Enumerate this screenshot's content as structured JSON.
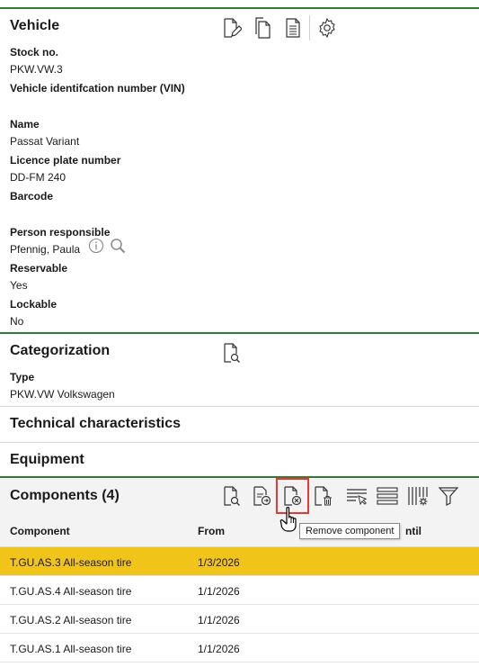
{
  "vehicle": {
    "title": "Vehicle",
    "fields": [
      {
        "label": "Stock no.",
        "value": "PKW.VW.3"
      },
      {
        "label": "Vehicle identifcation number (VIN)",
        "value": ""
      },
      {
        "label": "Name",
        "value": "Passat Variant"
      },
      {
        "label": "Licence plate number",
        "value": "DD-FM 240"
      },
      {
        "label": "Barcode",
        "value": ""
      },
      {
        "label": "Person responsible",
        "value": "Pfennig, Paula"
      },
      {
        "label": "Reservable",
        "value": "Yes"
      },
      {
        "label": "Lockable",
        "value": "No"
      }
    ],
    "toolbar_icons": [
      "edit-document-icon",
      "copy-document-icon",
      "document-icon",
      "settings-gear-icon"
    ]
  },
  "categorization": {
    "title": "Categorization",
    "type_label": "Type",
    "type_value": "PKW.VW Volkswagen"
  },
  "technical": {
    "title": "Technical characteristics"
  },
  "equipment": {
    "title": "Equipment"
  },
  "components": {
    "title": "Components (4)",
    "columns": [
      "Component",
      "From",
      "Until"
    ],
    "column_until_visible": "ntil",
    "rows": [
      {
        "component": "T.GU.AS.3 All-season tire",
        "from": "1/3/2026",
        "selected": true
      },
      {
        "component": "T.GU.AS.4 All-season tire",
        "from": "1/1/2026",
        "selected": false
      },
      {
        "component": "T.GU.AS.2 All-season tire",
        "from": "1/1/2026",
        "selected": false
      },
      {
        "component": "T.GU.AS.1 All-season tire",
        "from": "1/1/2026",
        "selected": false
      }
    ],
    "tooltip": "Remove component"
  },
  "colors": {
    "accent_green": "#2e7d32",
    "selected_row": "#f0c419",
    "highlight_red": "#e53935"
  }
}
